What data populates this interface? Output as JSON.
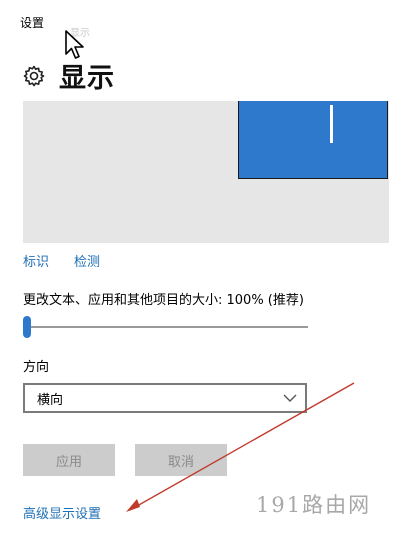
{
  "window": {
    "title": "设置",
    "ghost_text": "显示"
  },
  "header": {
    "title": "显示",
    "icon": "gear-icon"
  },
  "links": {
    "identify": "标识",
    "detect": "检测",
    "advanced": "高级显示设置"
  },
  "scale": {
    "label": "更改文本、应用和其他项目的大小: 100% (推荐)",
    "slider_value": 0
  },
  "orientation": {
    "label": "方向",
    "selected": "横向"
  },
  "buttons": {
    "apply": "应用",
    "cancel": "取消"
  },
  "watermark": "191路由网",
  "colors": {
    "accent": "#2f79cc",
    "link": "#1f6fb5",
    "preview_bg": "#e6e6e6",
    "button_disabled": "#cccccc",
    "annotation_arrow": "#c0392b"
  }
}
